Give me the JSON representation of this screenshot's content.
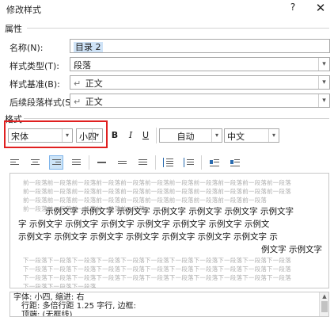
{
  "window": {
    "title": "修改样式",
    "help": "?",
    "close": "✕"
  },
  "properties": {
    "heading": "属性",
    "name_label": "名称(N):",
    "name_value": "目录 2",
    "type_label": "样式类型(T):",
    "type_value": "段落",
    "based_on_label": "样式基准(B):",
    "based_on_value": "正文",
    "next_label": "后续段落样式(S):",
    "next_value": "正文",
    "paragraph_mark": "↵"
  },
  "format": {
    "heading": "格式",
    "font": "宋体",
    "size": "小四",
    "bold": "B",
    "italic": "I",
    "underline": "U",
    "color": "自动",
    "script": "中文"
  },
  "preview": {
    "prev_line": "前一段落前一段落前一段落前一段落前一段落前一段落前一段落前一段落前一段落前一段落前一段落",
    "prev_line_short": "前一段落前一段落前一段落前一段落前一段落前一段落前一段落前一段落前一段落前一段落",
    "prev_line_last": "前一段落前一段落前一段落前一段落前一段落",
    "sample_lines": [
      "示例文字 示例文字 示例文字 示例文字 示例文字 示例文字 示例文字",
      "字 示例文字 示例文字 示例文字 示例文字 示例文字 示例文字 示例文",
      "示例文字 示例文字 示例文字 示例文字 示例文字 示例文字 示例文字 示",
      "例文字 示例文字"
    ],
    "next_line": "下一段落下一段落下一段落下一段落下一段落下一段落下一段落下一段落下一段落下一段落下一段落",
    "next_line_last": "下一段落下一段落下一段落"
  },
  "description": {
    "line1": "字体: 小四, 缩进: 右",
    "line2": "行距: 多倍行距 1.25 字行, 边框:",
    "line3": "顶端: (无框线)"
  },
  "icons": {
    "dropdown": "▾",
    "scroll_up": "▲"
  }
}
